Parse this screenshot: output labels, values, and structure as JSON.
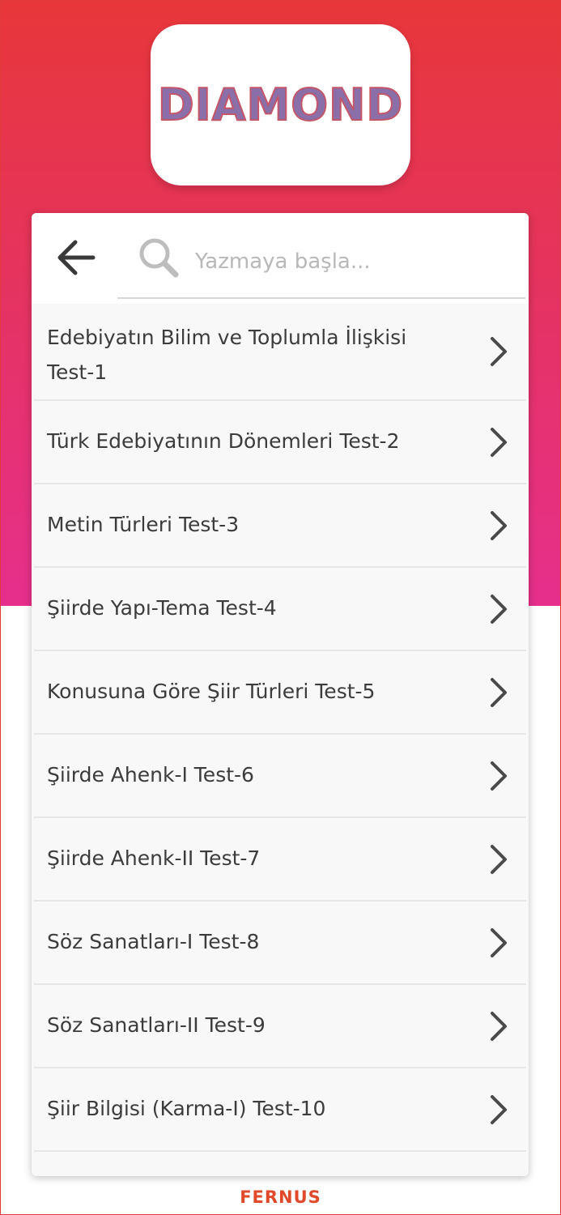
{
  "logo": {
    "text": "DIAMOND"
  },
  "search": {
    "back_icon": "arrow-left-icon",
    "search_icon": "search-icon",
    "placeholder": "Yazmaya başla...",
    "value": ""
  },
  "tests": [
    {
      "label": "Edebiyatın Bilim ve Toplumla İlişkisi Test-1"
    },
    {
      "label": "Türk Edebiyatının Dönemleri Test-2"
    },
    {
      "label": "Metin Türleri Test-3"
    },
    {
      "label": "Şiirde Yapı-Tema Test-4"
    },
    {
      "label": "Konusuna Göre Şiir Türleri Test-5"
    },
    {
      "label": "Şiirde Ahenk-I Test-6"
    },
    {
      "label": "Şiirde Ahenk-II Test-7"
    },
    {
      "label": "Söz Sanatları-I Test-8"
    },
    {
      "label": "Söz Sanatları-II Test-9"
    },
    {
      "label": "Şiir Bilgisi (Karma-I) Test-10"
    }
  ],
  "footer": {
    "brand": "FERNUS"
  },
  "colors": {
    "gradient_top": "#e8373a",
    "gradient_bottom": "#e62f8c",
    "brand": "#e04a2a"
  }
}
